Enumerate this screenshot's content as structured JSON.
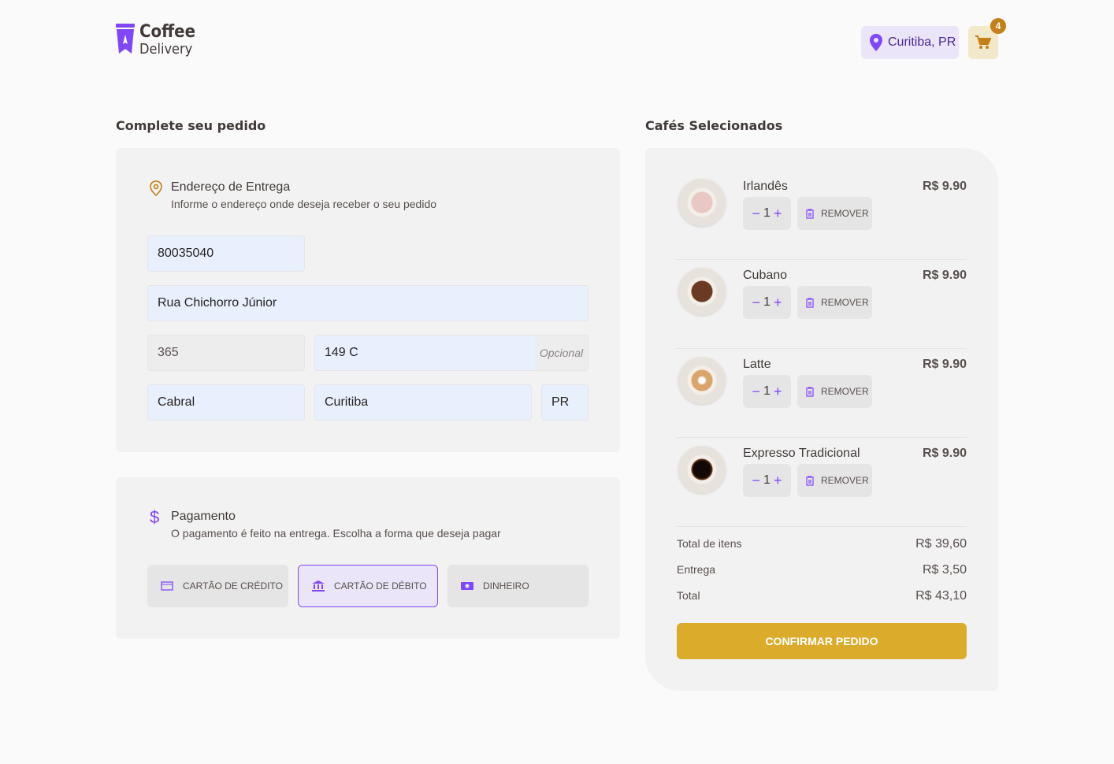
{
  "header": {
    "logo_line1": "Coffee",
    "logo_line2": "Delivery",
    "location": "Curitiba, PR",
    "cart_count": "4"
  },
  "checkout": {
    "title": "Complete seu pedido",
    "address": {
      "title": "Endereço de Entrega",
      "subtitle": "Informe o endereço onde deseja receber o seu pedido",
      "cep": "80035040",
      "rua": "Rua Chichorro Júnior",
      "numero": "365",
      "complemento": "149 C",
      "complemento_hint": "Opcional",
      "bairro": "Cabral",
      "cidade": "Curitiba",
      "uf": "PR"
    },
    "payment": {
      "title": "Pagamento",
      "subtitle": "O pagamento é feito na entrega. Escolha a forma que deseja pagar",
      "options": [
        {
          "label": "CARTÃO DE CRÉDITO"
        },
        {
          "label": "CARTÃO DE DÉBITO",
          "selected": true
        },
        {
          "label": "DINHEIRO"
        }
      ]
    }
  },
  "cart": {
    "title": "Cafés Selecionados",
    "items": [
      {
        "name": "Irlandês",
        "qty": "1",
        "price": "R$ 9.90",
        "remove": "REMOVER",
        "minus": "−",
        "plus": "+"
      },
      {
        "name": "Cubano",
        "qty": "1",
        "price": "R$ 9.90",
        "remove": "REMOVER",
        "minus": "−",
        "plus": "+"
      },
      {
        "name": "Latte",
        "qty": "1",
        "price": "R$ 9.90",
        "remove": "REMOVER",
        "minus": "−",
        "plus": "+"
      },
      {
        "name": "Expresso Tradicional",
        "qty": "1",
        "price": "R$ 9.90",
        "remove": "REMOVER",
        "minus": "−",
        "plus": "+"
      }
    ],
    "totals": {
      "items_label": "Total de itens",
      "items_value": "R$ 39,60",
      "delivery_label": "Entrega",
      "delivery_value": "R$ 3,50",
      "total_label": "Total",
      "total_value": "R$ 43,10"
    },
    "confirm": "CONFIRMAR PEDIDO"
  },
  "colors": {
    "purple": "#8047f8",
    "yellow": "#dbac2c",
    "yellow_dark": "#c47f17"
  }
}
